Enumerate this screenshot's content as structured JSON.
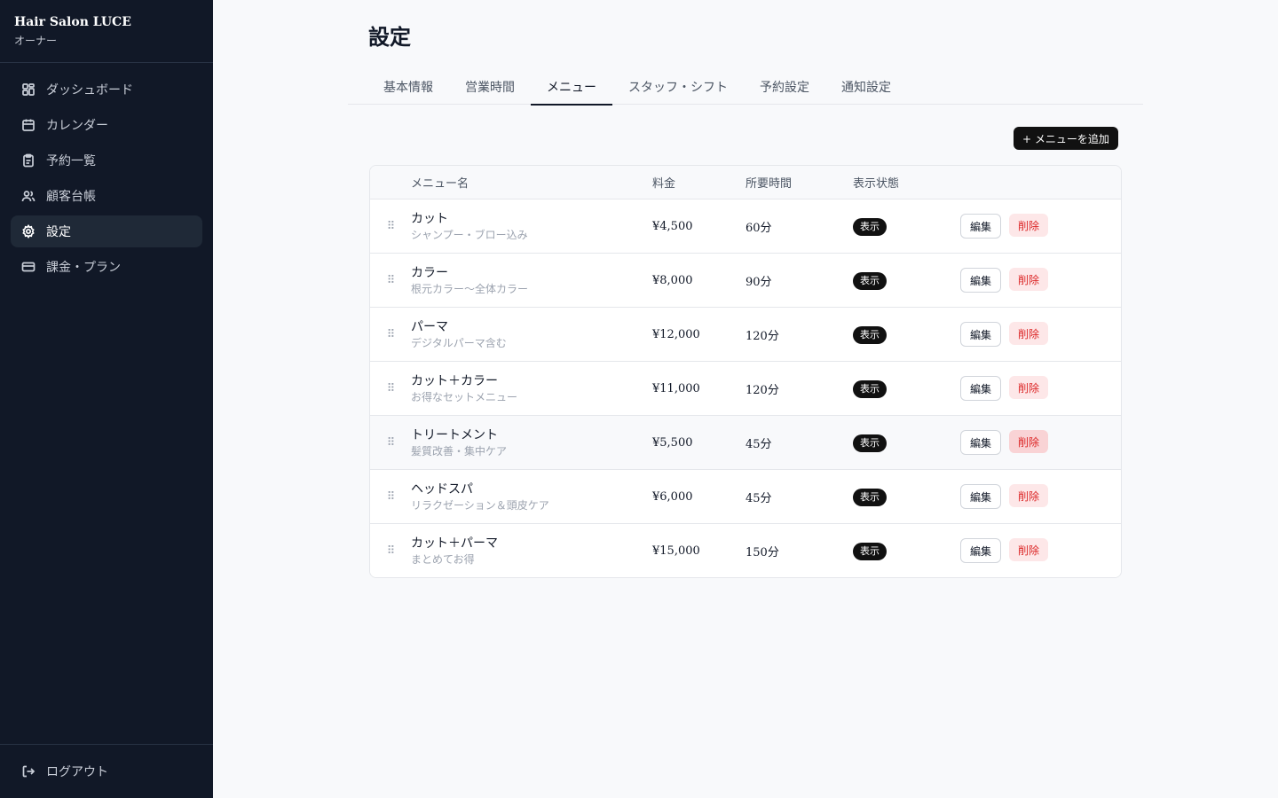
{
  "brand": {
    "name": "Hair Salon LUCE",
    "role": "オーナー"
  },
  "sidebar": {
    "items": [
      {
        "label": "ダッシュボード",
        "icon": "dashboard-icon"
      },
      {
        "label": "カレンダー",
        "icon": "calendar-icon"
      },
      {
        "label": "予約一覧",
        "icon": "clipboard-icon"
      },
      {
        "label": "顧客台帳",
        "icon": "users-icon"
      },
      {
        "label": "設定",
        "icon": "gear-icon",
        "active": true
      },
      {
        "label": "課金・プラン",
        "icon": "credit-card-icon"
      }
    ],
    "logout": {
      "label": "ログアウト",
      "icon": "logout-icon"
    }
  },
  "page": {
    "title": "設定"
  },
  "tabs": [
    {
      "label": "基本情報"
    },
    {
      "label": "営業時間"
    },
    {
      "label": "メニュー",
      "active": true
    },
    {
      "label": "スタッフ・シフト"
    },
    {
      "label": "予約設定"
    },
    {
      "label": "通知設定"
    }
  ],
  "toolbar": {
    "add_label": "+ メニューを追加"
  },
  "table": {
    "headers": {
      "name": "メニュー名",
      "price": "料金",
      "duration": "所要時間",
      "visibility": "表示状態"
    },
    "edit_label": "編集",
    "delete_label": "削除",
    "drag_icon": "drag-handle-icon",
    "rows": [
      {
        "name": "カット",
        "desc": "シャンプー・ブロー込み",
        "price": "¥4,500",
        "duration": "60分",
        "status": "表示"
      },
      {
        "name": "カラー",
        "desc": "根元カラー〜全体カラー",
        "price": "¥8,000",
        "duration": "90分",
        "status": "表示"
      },
      {
        "name": "パーマ",
        "desc": "デジタルパーマ含む",
        "price": "¥12,000",
        "duration": "120分",
        "status": "表示"
      },
      {
        "name": "カット＋カラー",
        "desc": "お得なセットメニュー",
        "price": "¥11,000",
        "duration": "120分",
        "status": "表示"
      },
      {
        "name": "トリートメント",
        "desc": "髪質改善・集中ケア",
        "price": "¥5,500",
        "duration": "45分",
        "status": "表示",
        "hover": true
      },
      {
        "name": "ヘッドスパ",
        "desc": "リラクゼーション＆頭皮ケア",
        "price": "¥6,000",
        "duration": "45分",
        "status": "表示"
      },
      {
        "name": "カット＋パーマ",
        "desc": "まとめてお得",
        "price": "¥15,000",
        "duration": "150分",
        "status": "表示"
      }
    ]
  },
  "colors": {
    "sidebar_bg": "#111827",
    "accent": "#111111",
    "danger": "#dc2626",
    "danger_bg": "#fde7e8"
  }
}
